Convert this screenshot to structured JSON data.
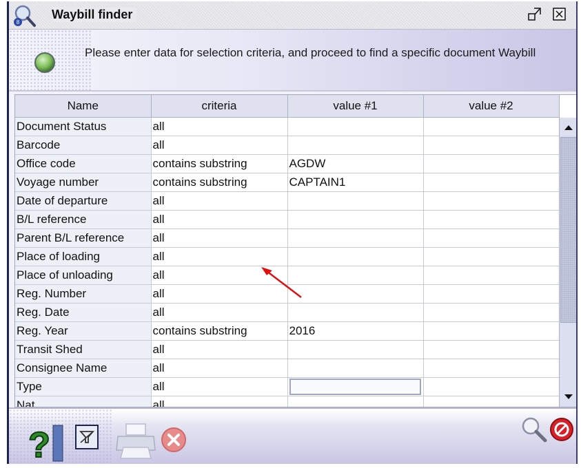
{
  "window": {
    "title": "Waybill finder",
    "info_text": "Please enter data for selection criteria, and proceed to find a specific document Waybill"
  },
  "grid": {
    "columns": [
      "Name",
      "criteria",
      "value #1",
      "value #2"
    ],
    "rows": [
      {
        "name": "Document Status",
        "criteria": "all",
        "v1": "",
        "v2": ""
      },
      {
        "name": "Barcode",
        "criteria": "all",
        "v1": "",
        "v2": ""
      },
      {
        "name": "Office code",
        "criteria": "contains substring",
        "v1": "AGDW",
        "v2": ""
      },
      {
        "name": "Voyage number",
        "criteria": "contains substring",
        "v1": "CAPTAIN1",
        "v2": ""
      },
      {
        "name": "Date of departure",
        "criteria": "all",
        "v1": "",
        "v2": ""
      },
      {
        "name": "B/L reference",
        "criteria": "all",
        "v1": "",
        "v2": ""
      },
      {
        "name": "Parent B/L reference",
        "criteria": "all",
        "v1": "",
        "v2": ""
      },
      {
        "name": "Place of loading",
        "criteria": "all",
        "v1": "",
        "v2": ""
      },
      {
        "name": "Place of unloading",
        "criteria": "all",
        "v1": "",
        "v2": ""
      },
      {
        "name": "Reg. Number",
        "criteria": "all",
        "v1": "",
        "v2": ""
      },
      {
        "name": "Reg. Date",
        "criteria": "all",
        "v1": "",
        "v2": ""
      },
      {
        "name": "Reg. Year",
        "criteria": "contains substring",
        "v1": "2016",
        "v2": ""
      },
      {
        "name": "Transit Shed",
        "criteria": "all",
        "v1": "",
        "v2": ""
      },
      {
        "name": "Consignee Name",
        "criteria": "all",
        "v1": "",
        "v2": ""
      },
      {
        "name": "Type",
        "criteria": "all",
        "v1": "",
        "v2": ""
      },
      {
        "name": "Nat...",
        "criteria": "all",
        "v1": "",
        "v2": ""
      }
    ]
  },
  "colors": {
    "arrow": "#e01010",
    "cancel": "#d8202a",
    "help": "#2e8a2a"
  },
  "toolbar_icons": [
    "help-icon",
    "filter-icon",
    "print-icon",
    "close-icon",
    "search-icon",
    "cancel-icon"
  ]
}
